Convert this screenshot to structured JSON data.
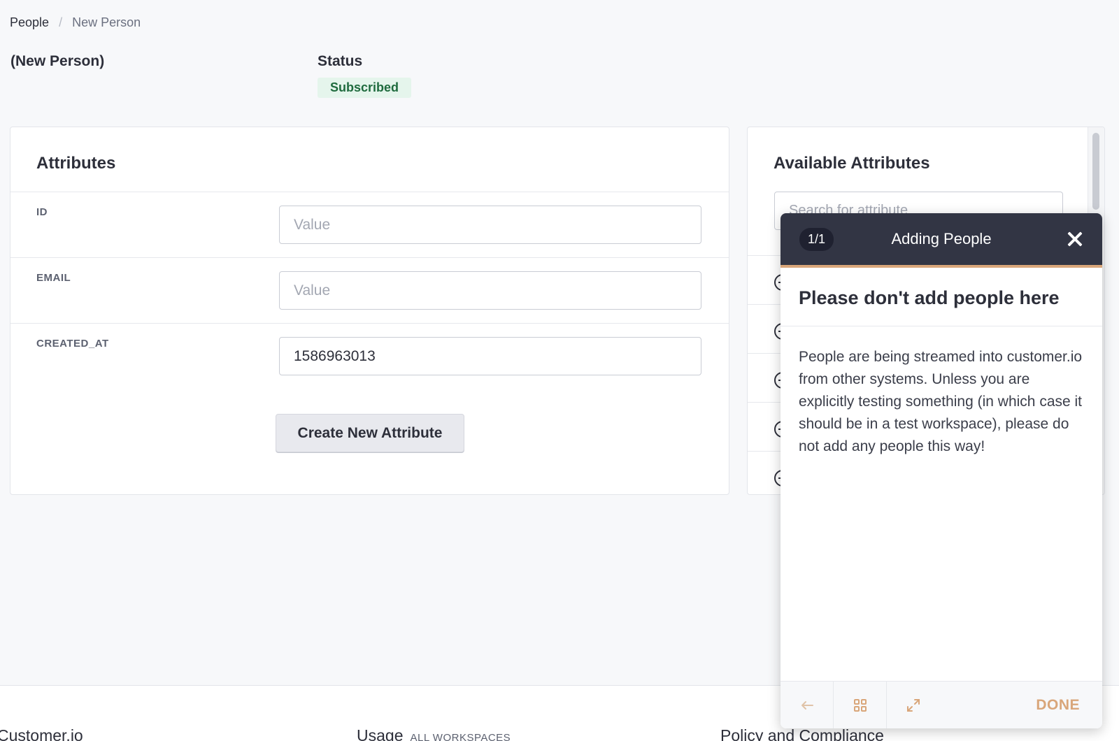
{
  "breadcrumb": {
    "root": "People",
    "separator": "/",
    "current": "New Person"
  },
  "page_title": "(New Person)",
  "status": {
    "label": "Status",
    "value": "Subscribed",
    "color": "#1f6b3e"
  },
  "attributes": {
    "title": "Attributes",
    "rows": [
      {
        "label": "ID",
        "value": "",
        "placeholder": "Value"
      },
      {
        "label": "EMAIL",
        "value": "",
        "placeholder": "Value"
      },
      {
        "label": "CREATED_AT",
        "value": "1586963013",
        "placeholder": "Value"
      }
    ],
    "create_button": "Create New Attribute"
  },
  "available": {
    "title": "Available Attributes",
    "search_placeholder": "Search for attribute"
  },
  "guide": {
    "step": "1/1",
    "title": "Adding People",
    "heading": "Please don't add people here",
    "body": "People are being streamed into customer.io from other systems. Unless you are explicitly testing something (in which case it should be in a test workspace), please do not add any people this way!",
    "done_label": "DONE",
    "accent": "#d9a67a"
  },
  "footer": {
    "col1": "Customer.io",
    "col2": "Usage",
    "col2_sub": "ALL WORKSPACES",
    "col3": "Policy and Compliance"
  }
}
